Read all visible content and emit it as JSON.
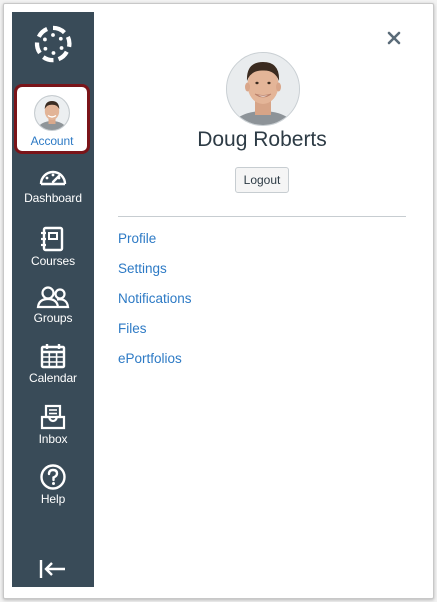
{
  "colors": {
    "sidebar_bg": "#394b58",
    "link": "#2d7ac5",
    "highlight_border": "#7a1419",
    "text": "#2d3b45"
  },
  "sidebar": {
    "logo_icon": "canvas-logo-icon",
    "account": {
      "label": "Account",
      "icon": "avatar"
    },
    "items": [
      {
        "label": "Dashboard",
        "icon": "dashboard-icon"
      },
      {
        "label": "Courses",
        "icon": "courses-icon"
      },
      {
        "label": "Groups",
        "icon": "groups-icon"
      },
      {
        "label": "Calendar",
        "icon": "calendar-icon"
      },
      {
        "label": "Inbox",
        "icon": "inbox-icon"
      },
      {
        "label": "Help",
        "icon": "help-icon"
      }
    ],
    "collapse_icon": "collapse-arrow-icon"
  },
  "tray": {
    "close_icon": "close-icon",
    "user_name": "Doug Roberts",
    "logout_label": "Logout",
    "links": [
      {
        "label": "Profile"
      },
      {
        "label": "Settings"
      },
      {
        "label": "Notifications"
      },
      {
        "label": "Files"
      },
      {
        "label": "ePortfolios"
      }
    ]
  }
}
